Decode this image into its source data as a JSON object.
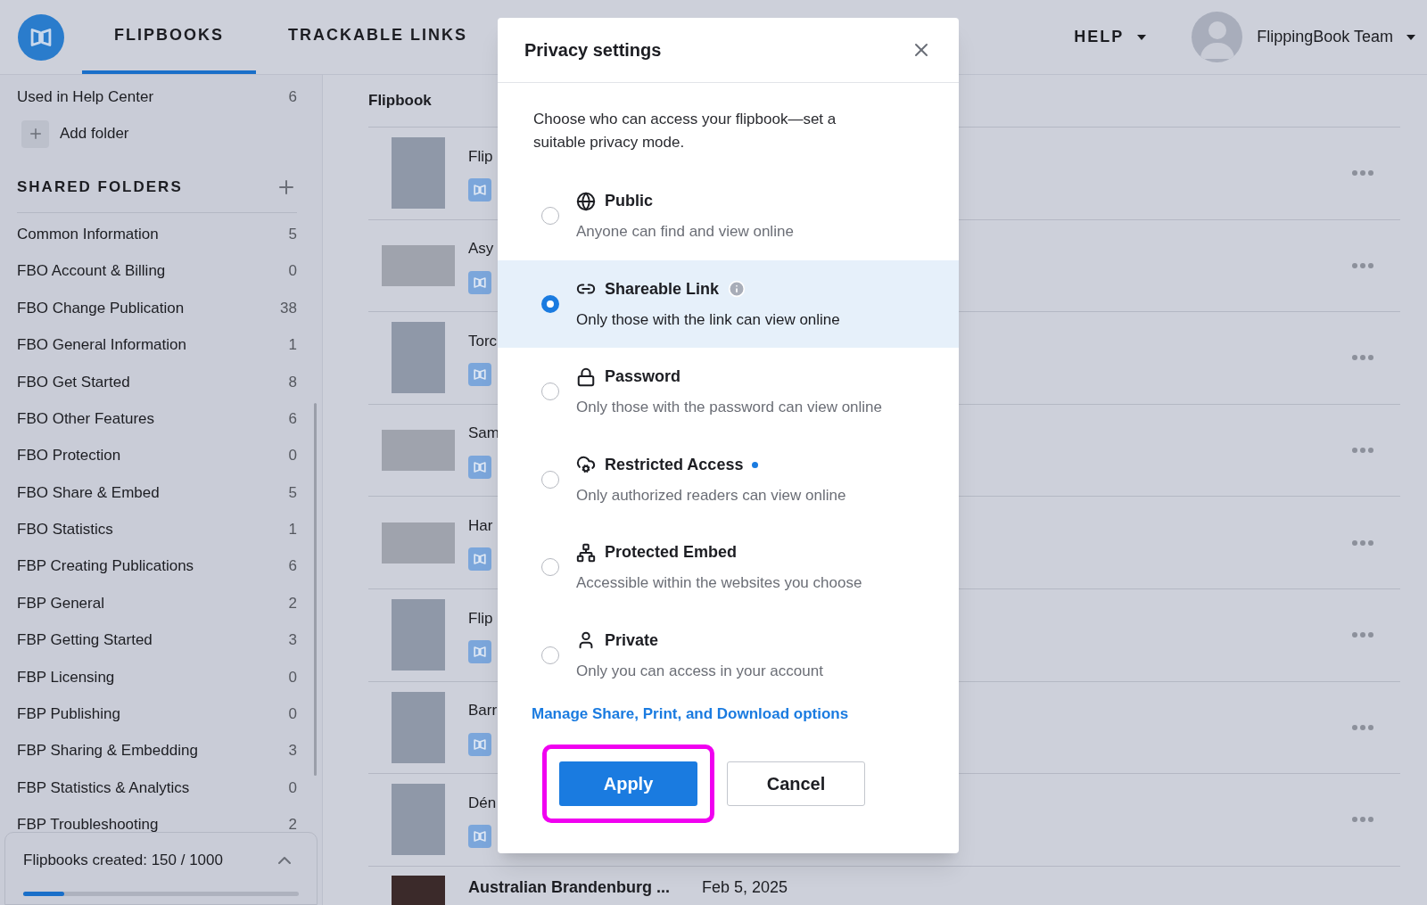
{
  "header": {
    "tabs": [
      {
        "label": "FLIPBOOKS",
        "selected": true
      },
      {
        "label": "TRACKABLE LINKS",
        "selected": false
      }
    ],
    "help": "HELP",
    "user": "FlippingBook Team"
  },
  "sidebar": {
    "top_items": [
      {
        "name": "Used in Help Center",
        "count": "6"
      }
    ],
    "add_folder": "Add folder",
    "shared_heading": "SHARED FOLDERS",
    "folders": [
      {
        "name": "Common Information",
        "count": "5"
      },
      {
        "name": "FBO Account & Billing",
        "count": "0"
      },
      {
        "name": "FBO Change Publication",
        "count": "38"
      },
      {
        "name": "FBO General Information",
        "count": "1"
      },
      {
        "name": "FBO Get Started",
        "count": "8"
      },
      {
        "name": "FBO Other Features",
        "count": "6"
      },
      {
        "name": "FBO Protection",
        "count": "0"
      },
      {
        "name": "FBO Share & Embed",
        "count": "5"
      },
      {
        "name": "FBO Statistics",
        "count": "1"
      },
      {
        "name": "FBP Creating Publications",
        "count": "6"
      },
      {
        "name": "FBP General",
        "count": "2"
      },
      {
        "name": "FBP Getting Started",
        "count": "3"
      },
      {
        "name": "FBP Licensing",
        "count": "0"
      },
      {
        "name": "FBP Publishing",
        "count": "0"
      },
      {
        "name": "FBP Sharing & Embedding",
        "count": "3"
      },
      {
        "name": "FBP Statistics & Analytics",
        "count": "0"
      },
      {
        "name": "FBP Troubleshooting",
        "count": "2"
      }
    ],
    "quota": {
      "text": "Flipbooks created: 150 / 1000",
      "level": 0.15,
      "expanded": true
    }
  },
  "list": {
    "column": "Flipbook",
    "rows": [
      {
        "title": "Flip",
        "kind": "portrait"
      },
      {
        "title": "Asy",
        "kind": "landscape"
      },
      {
        "title": "Torc",
        "kind": "portrait"
      },
      {
        "title": "Sam",
        "kind": "landscape"
      },
      {
        "title": "Har",
        "kind": "landscape"
      },
      {
        "title": "Flip",
        "kind": "portrait"
      },
      {
        "title": "Barr",
        "kind": "portrait"
      },
      {
        "title": "Dén",
        "kind": "portrait"
      }
    ],
    "last_row": {
      "title": "Australian Brandenburg ...",
      "date": "Feb 5, 2025"
    }
  },
  "dialog": {
    "title": "Privacy settings",
    "description": "Choose who can access your flipbook—set a suitable privacy mode.",
    "options": [
      {
        "kind": "public",
        "label": "Public",
        "hint": "Anyone can find and view online",
        "selected": false,
        "info": false,
        "new": false
      },
      {
        "kind": "link",
        "label": "Shareable Link",
        "hint": "Only those with the link can view online",
        "selected": true,
        "info": true,
        "new": false
      },
      {
        "kind": "password",
        "label": "Password",
        "hint": "Only those with the password can view online",
        "selected": false,
        "info": false,
        "new": false
      },
      {
        "kind": "restricted",
        "label": "Restricted Access",
        "hint": "Only authorized readers can view online",
        "selected": false,
        "info": false,
        "new": true
      },
      {
        "kind": "embed",
        "label": "Protected Embed",
        "hint": "Accessible within the websites you choose",
        "selected": false,
        "info": false,
        "new": false
      },
      {
        "kind": "private",
        "label": "Private",
        "hint": "Only you can access in your account",
        "selected": false,
        "info": false,
        "new": false
      }
    ],
    "link": "Manage Share, Print, and Download options",
    "apply": "Apply",
    "cancel": "Cancel",
    "apply_highlighted": true
  }
}
